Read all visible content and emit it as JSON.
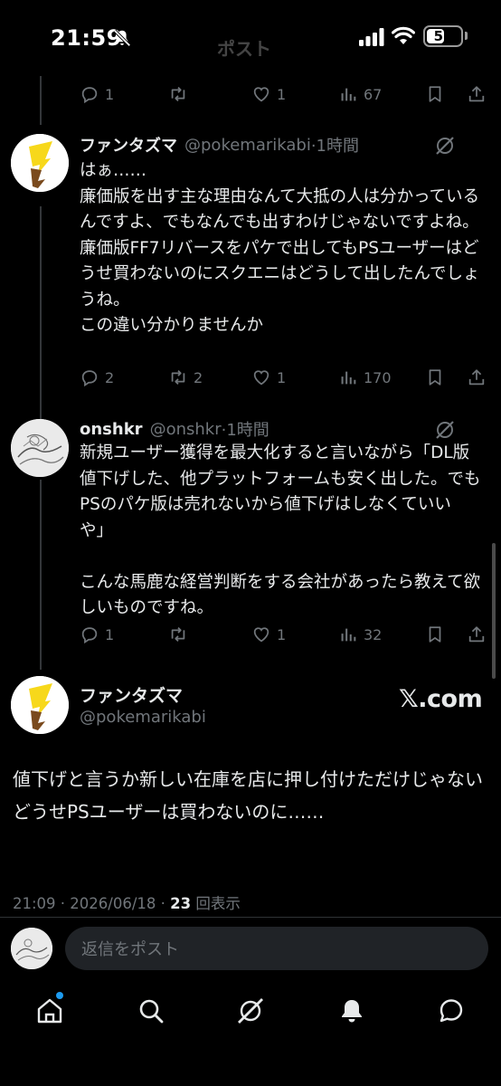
{
  "status_bar": {
    "time": "21:59",
    "faded_title": "ポスト",
    "battery": "52",
    "battery_level": 0.52
  },
  "tweets": [
    {
      "stats": {
        "replies": "1",
        "reposts": "",
        "likes": "1",
        "views": "67"
      }
    },
    {
      "name": "ファンタズマ",
      "handle": "@pokemarikabi",
      "time": "·1時間",
      "body": "はぁ……\n廉価版を出す主な理由なんて大抵の人は分かっているんですよ、でもなんでも出すわけじゃないですよね。\n廉価版FF7リバースをパケで出してもPSユーザーはどうせ買わないのにスクエニはどうして出したんでしょうね。\nこの違い分かりませんか",
      "stats": {
        "replies": "2",
        "reposts": "2",
        "likes": "1",
        "views": "170"
      }
    },
    {
      "name": "onshkr",
      "handle": "@onshkr",
      "time": "·1時間",
      "body": "新規ユーザー獲得を最大化すると言いながら「DL版値下げした、他プラットフォームも安く出した。でもPSのパケ版は売れないから値下げはしなくていいや」\n\nこんな馬鹿な経営判断をする会社があったら教えて欲しいものですね。",
      "stats": {
        "replies": "1",
        "reposts": "",
        "likes": "1",
        "views": "32"
      }
    }
  ],
  "main_tweet": {
    "name": "ファンタズマ",
    "handle": "@pokemarikabi",
    "source_badge": "𝕏.com",
    "body": "値下げと言うか新しい在庫を店に押し付けただけじゃない\nどうせPSユーザーは買わないのに……",
    "timestamp": "21:09 · 2026/06/18 · ",
    "views_count": "23",
    "views_label": " 回表示"
  },
  "reply": {
    "placeholder": "返信をポスト"
  },
  "nav": [
    "home-icon",
    "search-icon",
    "grok-icon",
    "notifications-icon",
    "messages-icon"
  ],
  "colors": {
    "background": "#000000",
    "text": "#e7e9ea",
    "muted": "#71767b",
    "accent": "#1d9bf0"
  }
}
